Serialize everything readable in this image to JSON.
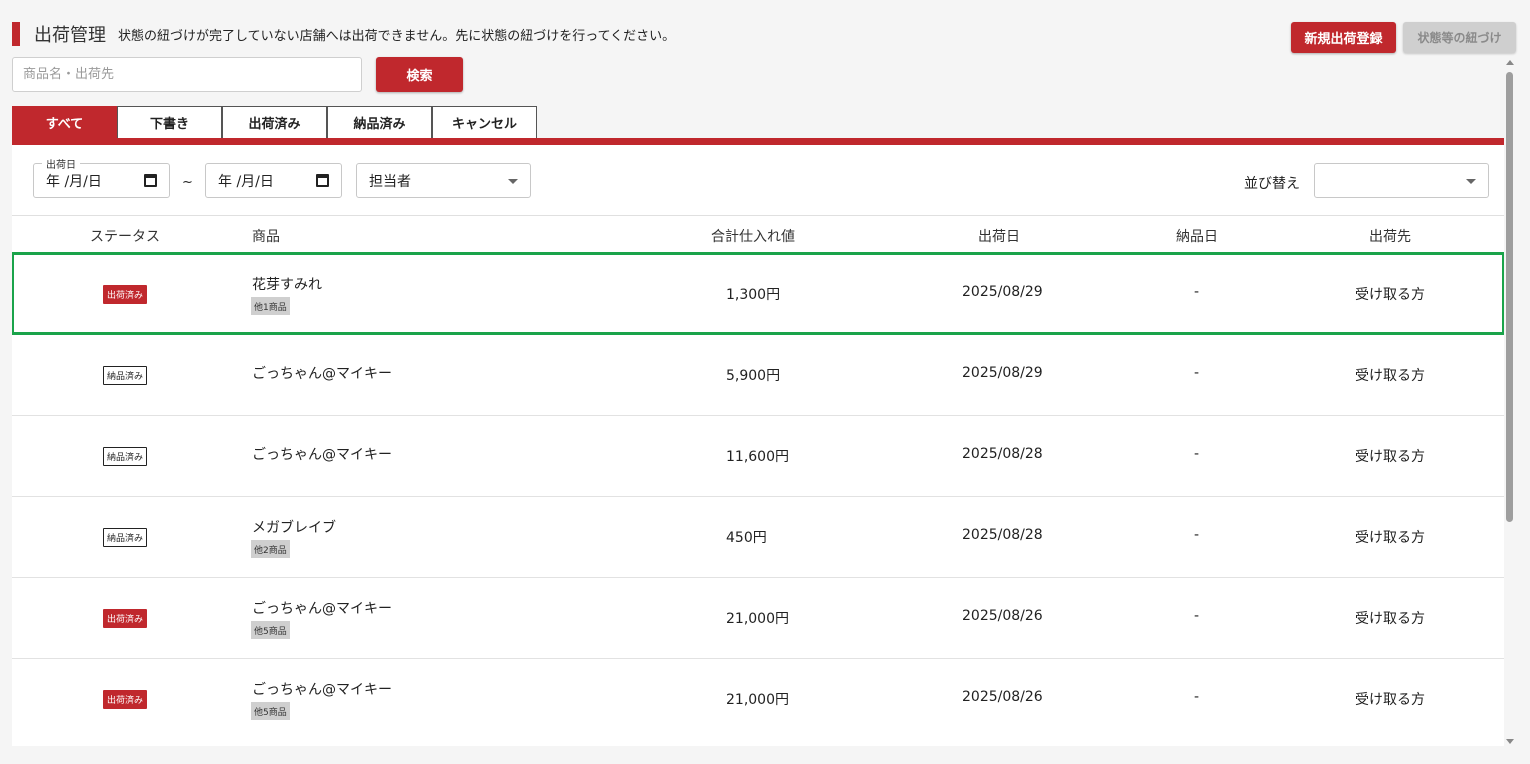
{
  "header": {
    "title": "出荷管理",
    "notice": "状態の紐づけが完了していない店舗へは出荷できません。先に状態の紐づけを行ってください。",
    "new_button": "新規出荷登録",
    "link_button": "状態等の紐づけ"
  },
  "search": {
    "placeholder": "商品名・出荷先",
    "button": "検索"
  },
  "tabs": [
    "すべて",
    "下書き",
    "出荷済み",
    "納品済み",
    "キャンセル"
  ],
  "active_tab": "すべて",
  "filters": {
    "ship_date_label": "出荷日",
    "date_from": "年 /月/日",
    "date_to": "年 /月/日",
    "range_sep": "~",
    "assignee": "担当者",
    "sort_label": "並び替え",
    "sort_value": ""
  },
  "table": {
    "headers": {
      "status": "ステータス",
      "product": "商品",
      "total": "合計仕入れ値",
      "ship_date": "出荷日",
      "delivery_date": "納品日",
      "destination": "出荷先"
    },
    "rows": [
      {
        "status": "出荷済み",
        "status_type": "shipped",
        "product": "花芽すみれ",
        "more": "他1商品",
        "total": "1,300円",
        "ship_date": "2025/08/29",
        "delivery_date": "-",
        "destination": "受け取る方"
      },
      {
        "status": "納品済み",
        "status_type": "delivered",
        "product": "ごっちゃん@マイキー",
        "more": "",
        "total": "5,900円",
        "ship_date": "2025/08/29",
        "delivery_date": "-",
        "destination": "受け取る方"
      },
      {
        "status": "納品済み",
        "status_type": "delivered",
        "product": "ごっちゃん@マイキー",
        "more": "",
        "total": "11,600円",
        "ship_date": "2025/08/28",
        "delivery_date": "-",
        "destination": "受け取る方"
      },
      {
        "status": "納品済み",
        "status_type": "delivered",
        "product": "メガブレイブ",
        "more": "他2商品",
        "total": "450円",
        "ship_date": "2025/08/28",
        "delivery_date": "-",
        "destination": "受け取る方"
      },
      {
        "status": "出荷済み",
        "status_type": "shipped",
        "product": "ごっちゃん@マイキー",
        "more": "他5商品",
        "total": "21,000円",
        "ship_date": "2025/08/26",
        "delivery_date": "-",
        "destination": "受け取る方"
      },
      {
        "status": "出荷済み",
        "status_type": "shipped",
        "product": "ごっちゃん@マイキー",
        "more": "他5商品",
        "total": "21,000円",
        "ship_date": "2025/08/26",
        "delivery_date": "-",
        "destination": "受け取る方"
      }
    ]
  },
  "colors": {
    "accent": "#c0282d",
    "highlight": "#1aa34a"
  },
  "icons": {
    "date": "calendar-icon",
    "select": "chevron-down-icon"
  }
}
